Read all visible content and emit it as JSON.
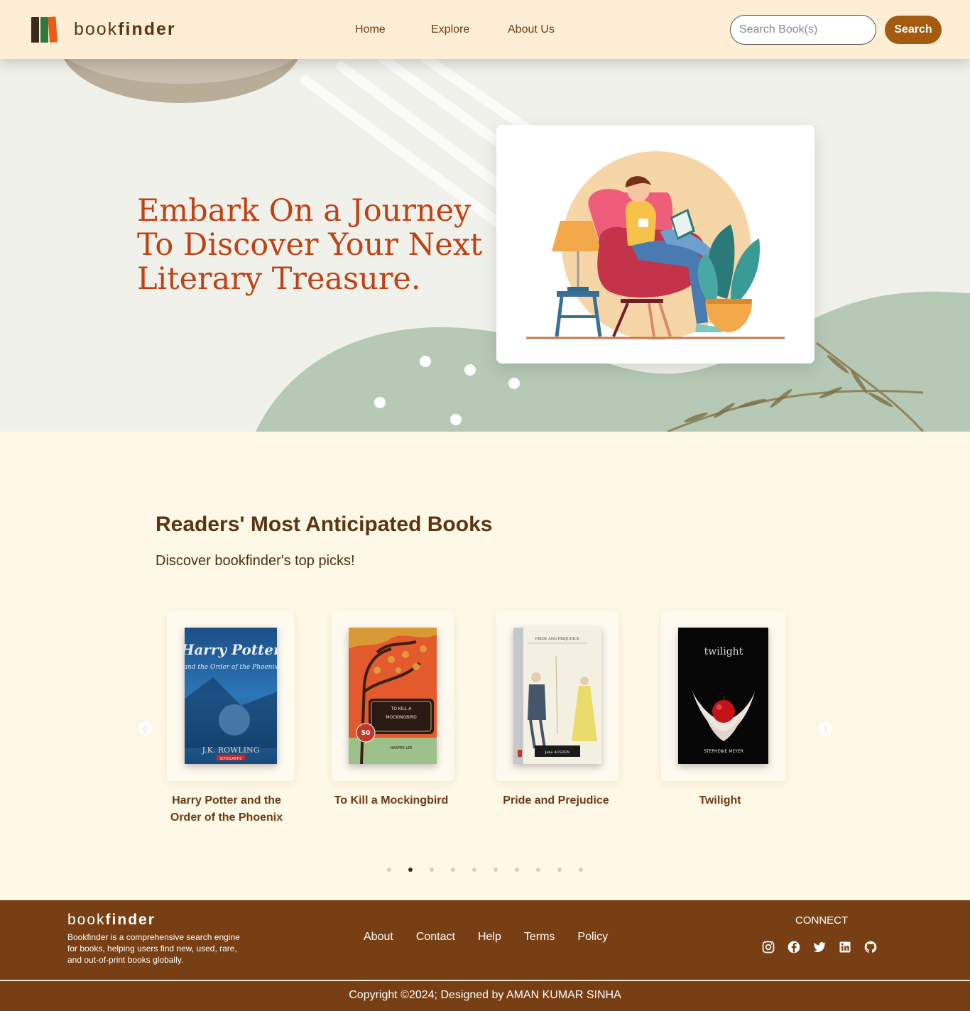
{
  "nav": {
    "brand_light": "book",
    "brand_bold": "finder",
    "links": [
      "Home",
      "Explore",
      "About Us"
    ],
    "search_placeholder": "Search Book(s)",
    "search_button": "Search"
  },
  "hero": {
    "title": "Embark On a Journey To Discover Your Next Literary Treasure."
  },
  "section": {
    "title": "Readers' Most Anticipated Books",
    "subtitle": "Discover bookfinder's top picks!"
  },
  "books": [
    {
      "title": "Harry Potter and the Order of the Phoenix",
      "cover_texts": [
        "Harry Potter",
        "and the Order of the Phoenix",
        "J.K. ROWLING",
        "SCHOLASTIC"
      ]
    },
    {
      "title": "To Kill a Mockingbird",
      "cover_texts": [
        "TO KILL A",
        "MOCKINGBIRD",
        "HARPER LEE",
        "50"
      ]
    },
    {
      "title": "Pride and Prejudice",
      "cover_texts": [
        "PRIDE AND PREJUDICE",
        "Jane AUSTEN"
      ]
    },
    {
      "title": "Twilight",
      "cover_texts": [
        "twilight",
        "STEPHENIE MEYER"
      ]
    }
  ],
  "carousel": {
    "dot_count": 10,
    "active_index": 1
  },
  "footer": {
    "brand_light": "book",
    "brand_bold": "finder",
    "description": "Bookfinder is a comprehensive search engine for books, helping users find new, used, rare, and out-of-print books globally.",
    "links": [
      "About",
      "Contact",
      "Help",
      "Terms",
      "Policy"
    ],
    "connect_label": "CONNECT",
    "social_icons": [
      "instagram-icon",
      "facebook-icon",
      "twitter-icon",
      "linkedin-icon",
      "github-icon"
    ],
    "copyright": "Copyright ©2024; Designed by AMAN KUMAR SINHA"
  },
  "colors": {
    "nav_bg": "#ffeed6",
    "accent": "#a45a0f",
    "hero_title": "#bf4212",
    "footer_bg": "#773f13",
    "page_bg": "#fef9e7"
  }
}
